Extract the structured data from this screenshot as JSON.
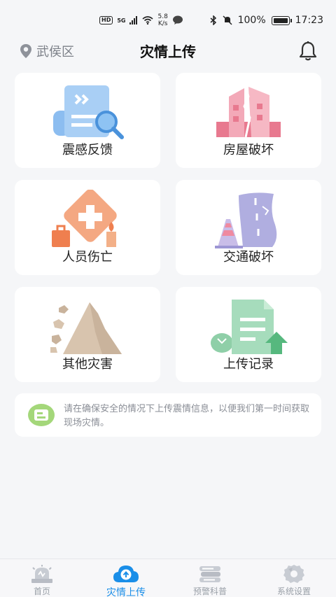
{
  "status_bar": {
    "hd_badge": "HD",
    "network": "5G",
    "speed_value": "5.8",
    "speed_unit": "K/s",
    "battery": "100%",
    "time": "17:23"
  },
  "header": {
    "location": "武侯区",
    "title": "灾情上传"
  },
  "cards": [
    {
      "label": "震感反馈",
      "icon": "document-search-icon"
    },
    {
      "label": "房屋破坏",
      "icon": "cracked-building-icon"
    },
    {
      "label": "人员伤亡",
      "icon": "first-aid-icon"
    },
    {
      "label": "交通破坏",
      "icon": "cracked-road-icon"
    },
    {
      "label": "其他灾害",
      "icon": "landslide-icon"
    },
    {
      "label": "上传记录",
      "icon": "upload-record-icon"
    }
  ],
  "notice": {
    "text": "请在确保安全的情况下上传震情信息，以便我们第一时间获取现场灾情。"
  },
  "nav": [
    {
      "label": "首页",
      "icon": "alarm-icon"
    },
    {
      "label": "灾情上传",
      "icon": "cloud-upload-icon",
      "active": true
    },
    {
      "label": "预警科普",
      "icon": "book-stack-icon"
    },
    {
      "label": "系统设置",
      "icon": "settings-icon"
    }
  ],
  "colors": {
    "accent": "#1a8ee8",
    "background": "#f5f6f8",
    "card": "#ffffff",
    "muted_text": "#8a8e96"
  }
}
